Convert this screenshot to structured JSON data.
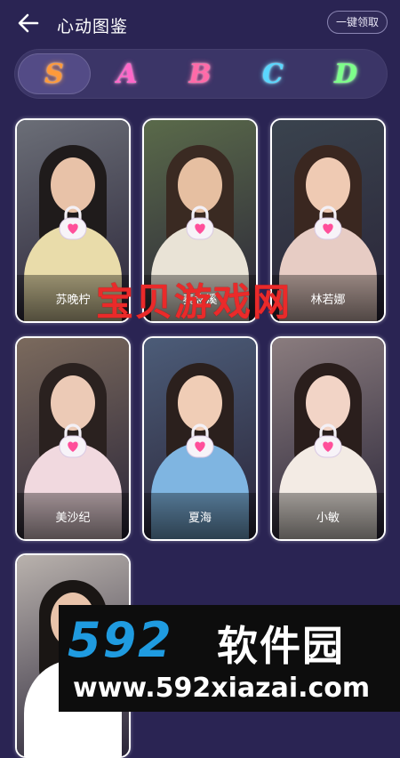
{
  "header": {
    "title": "心动图鉴",
    "claim_all_label": "一键领取"
  },
  "tiers": [
    {
      "label": "S",
      "color": "#ff9a3a",
      "active": true
    },
    {
      "label": "A",
      "color": "#ff67c9",
      "active": false
    },
    {
      "label": "B",
      "color": "#ff6aa8",
      "active": false
    },
    {
      "label": "C",
      "color": "#5ad7ff",
      "active": false
    },
    {
      "label": "D",
      "color": "#7dff8a",
      "active": false
    }
  ],
  "cards": [
    {
      "name": "苏晚柠",
      "locked": true,
      "bg": "#6b6e77",
      "skin": "#e8c2a8",
      "hair": "#1f1b1b",
      "outfit": "#e9dcaa"
    },
    {
      "name": "秦念溪",
      "locked": true,
      "bg": "#5a6a4a",
      "skin": "#e6bfa1",
      "hair": "#3a2a22",
      "outfit": "#e9e3d6"
    },
    {
      "name": "林若娜",
      "locked": true,
      "bg": "#3a434e",
      "skin": "#efcab3",
      "hair": "#3a2720",
      "outfit": "#e7ccc4"
    },
    {
      "name": "美沙纪",
      "locked": true,
      "bg": "#7b6a5d",
      "skin": "#eccab6",
      "hair": "#2a211f",
      "outfit": "#f1d9df"
    },
    {
      "name": "夏海",
      "locked": true,
      "bg": "#4c5c78",
      "skin": "#f0cdb6",
      "hair": "#2b201d",
      "outfit": "#7fb5e1"
    },
    {
      "name": "小敏",
      "locked": true,
      "bg": "#8a7c7e",
      "skin": "#f2d4c6",
      "hair": "#2a1e1c",
      "outfit": "#f3ebe4"
    },
    {
      "name": "",
      "locked": false,
      "bg": "#b9b2ad",
      "skin": "#e8c3aa",
      "hair": "#1a1614",
      "outfit": "#ffffff"
    }
  ],
  "watermark": {
    "overlay_text": "宝贝游戏网",
    "logo_number": "592",
    "logo_text": "软件园",
    "url": "www.592xiazai.com"
  }
}
